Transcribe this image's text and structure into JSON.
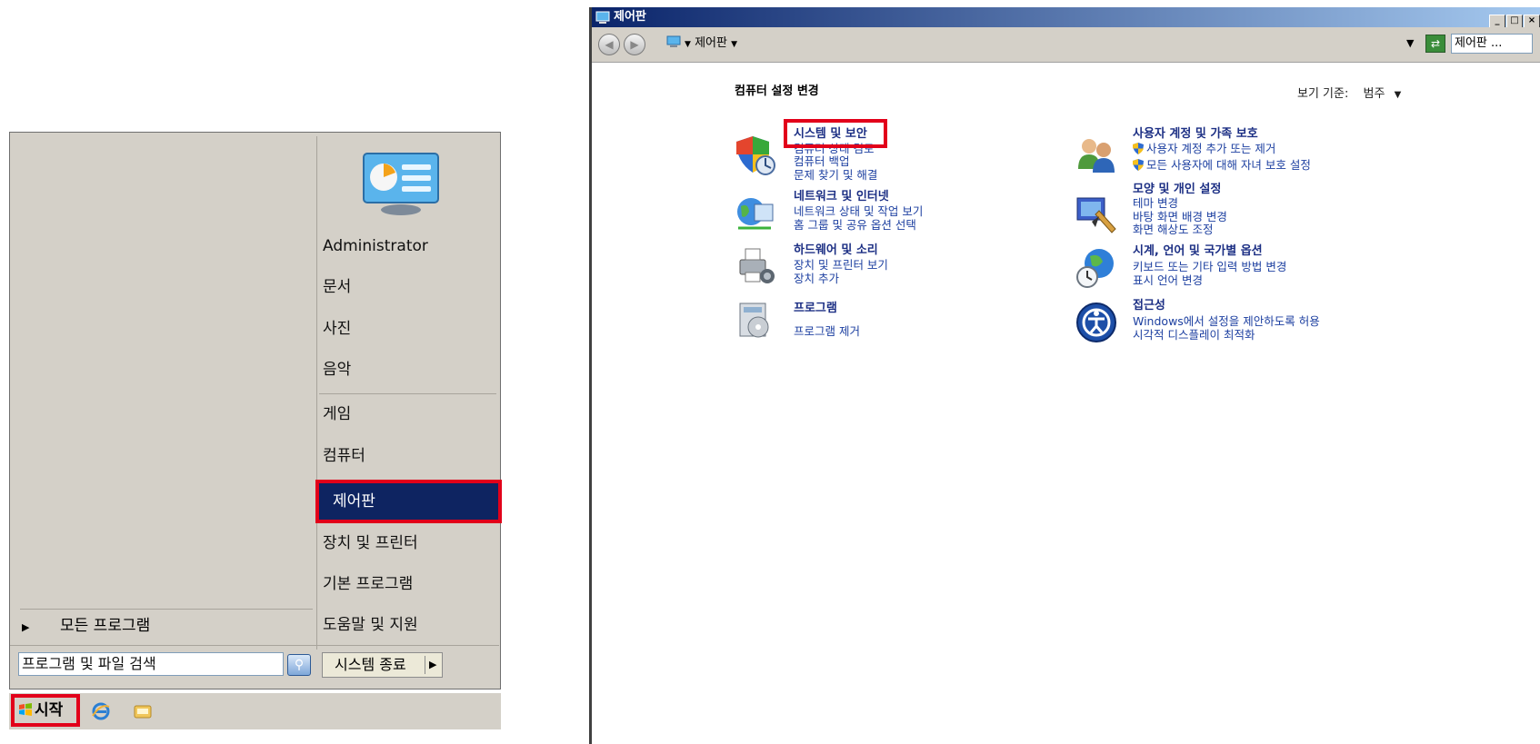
{
  "start_menu": {
    "user": "Administrator",
    "items": [
      "문서",
      "사진",
      "음악",
      "게임",
      "컴퓨터",
      "제어판",
      "장치 및 프린터",
      "기본 프로그램",
      "도움말 및 지원"
    ],
    "all_programs": "모든 프로그램",
    "search_placeholder": "프로그램 및 파일 검색",
    "shutdown": "시스템 종료"
  },
  "taskbar": {
    "start_label": "시작"
  },
  "control_panel": {
    "window_title": "제어판",
    "breadcrumb": "제어판",
    "search_value": "제어판 ...",
    "heading": "컴퓨터 설정 변경",
    "view_by_label": "보기 기준:",
    "view_by_value": "범주",
    "categories": [
      {
        "title": "시스템 및 보안",
        "links": [
          "컴퓨터 상태 검토",
          "컴퓨터 백업",
          "문제 찾기 및 해결"
        ]
      },
      {
        "title": "네트워크 및 인터넷",
        "links": [
          "네트워크 상태 및 작업 보기",
          "홈 그룹 및 공유 옵션 선택"
        ]
      },
      {
        "title": "하드웨어 및 소리",
        "links": [
          "장치 및 프린터 보기",
          "장치 추가"
        ]
      },
      {
        "title": "프로그램",
        "links": [
          "프로그램 제거"
        ]
      },
      {
        "title": "사용자 계정 및 가족 보호",
        "links": [
          "사용자 계정 추가 또는 제거",
          "모든 사용자에 대해 자녀 보호 설정"
        ]
      },
      {
        "title": "모양 및 개인 설정",
        "links": [
          "테마 변경",
          "바탕 화면 배경 변경",
          "화면 해상도 조정"
        ]
      },
      {
        "title": "시계, 언어 및 국가별 옵션",
        "links": [
          "키보드 또는 기타 입력 방법 변경",
          "표시 언어 변경"
        ]
      },
      {
        "title": "접근성",
        "links": [
          "Windows에서 설정을 제안하도록 허용",
          "시각적 디스플레이 최적화"
        ]
      }
    ]
  },
  "colors": {
    "highlight_box": "#e2001a",
    "selected_bg": "#0e2461",
    "link": "#1c3fa0"
  }
}
